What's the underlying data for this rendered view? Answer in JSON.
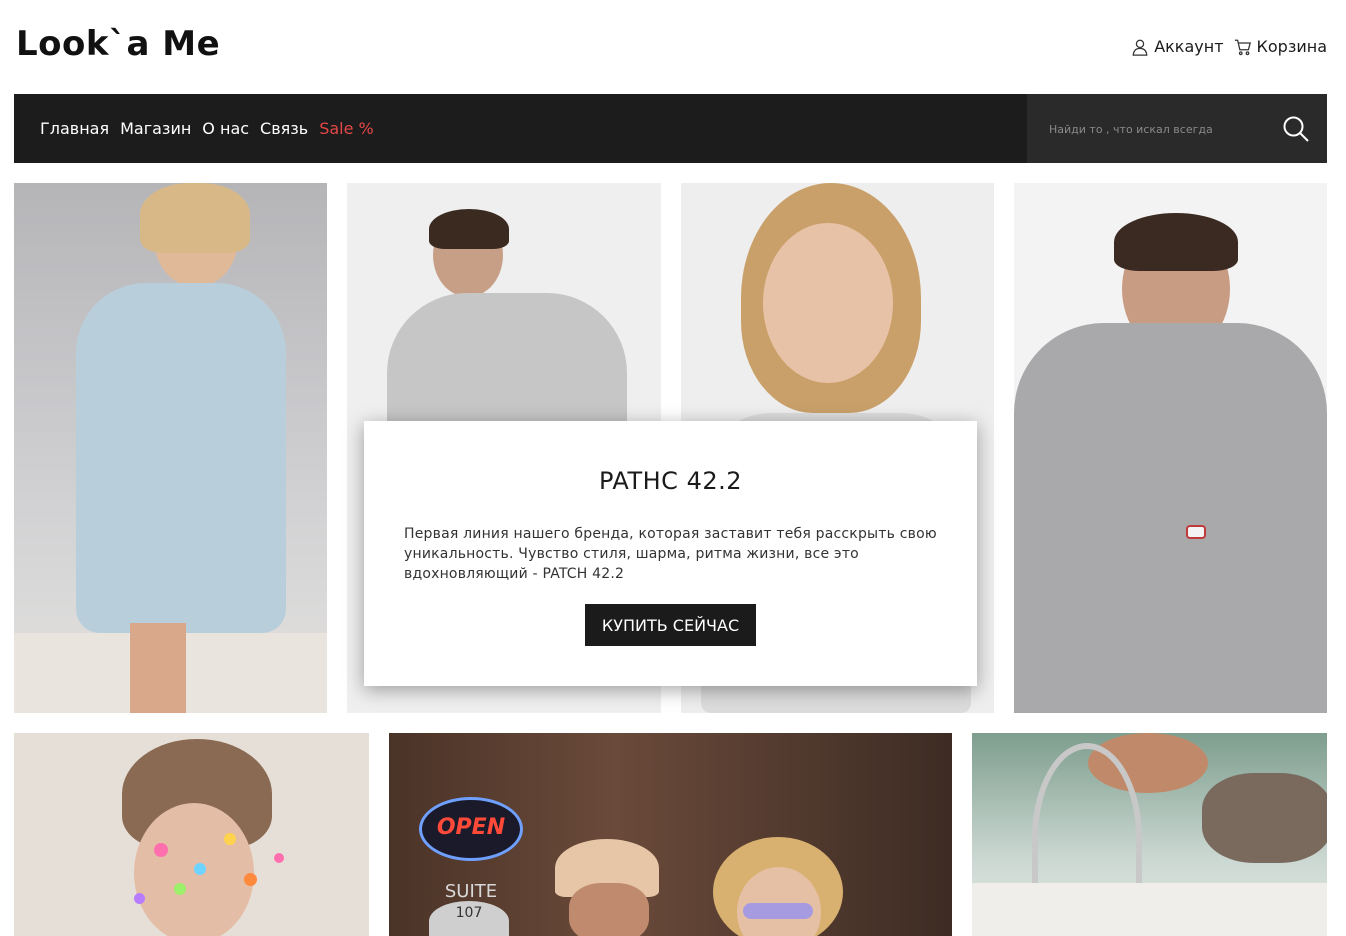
{
  "logo": "Look`a Me",
  "header": {
    "account_label": "Аккаунт",
    "cart_label": "Корзина"
  },
  "nav": {
    "items": [
      "Главная",
      "Магазин",
      "О нас",
      "Связь"
    ],
    "sale_label": "Sale %",
    "sale_color": "#e44747"
  },
  "search": {
    "placeholder": "Найди то , что искал всегда"
  },
  "promo": {
    "title": "PATHC 42.2",
    "text": "Первая линия нашего бренда, которая заставит тебя расскрыть свою уникальность. Чувство стиля, шарма, ритма жизни, все это вдохновляющий - PATCH 42.2",
    "button_label": "КУПИТЬ СЕЙЧАС"
  },
  "gallery": {
    "sign_open": "OPEN",
    "sign_suite": "SUITE",
    "sign_number": "107"
  },
  "colors": {
    "navbar": "#1c1c1c",
    "search_bg": "#2a2a2a",
    "button": "#1b1b1b"
  }
}
